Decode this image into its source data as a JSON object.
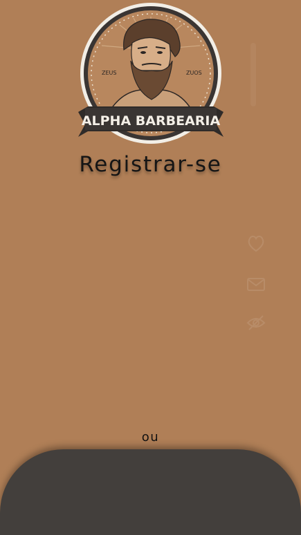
{
  "logo": {
    "brand": "ALPHA BARBEARIA",
    "left_text": "ZEUS",
    "right_text": "ZUOS"
  },
  "page": {
    "title": "Registrar-se",
    "or_separator": "ou"
  },
  "form_icons": [
    "user-icon",
    "mail-icon",
    "eye-off-icon"
  ],
  "colors": {
    "background": "#B07F57",
    "panel": "#433F3C",
    "text": "#151515"
  }
}
